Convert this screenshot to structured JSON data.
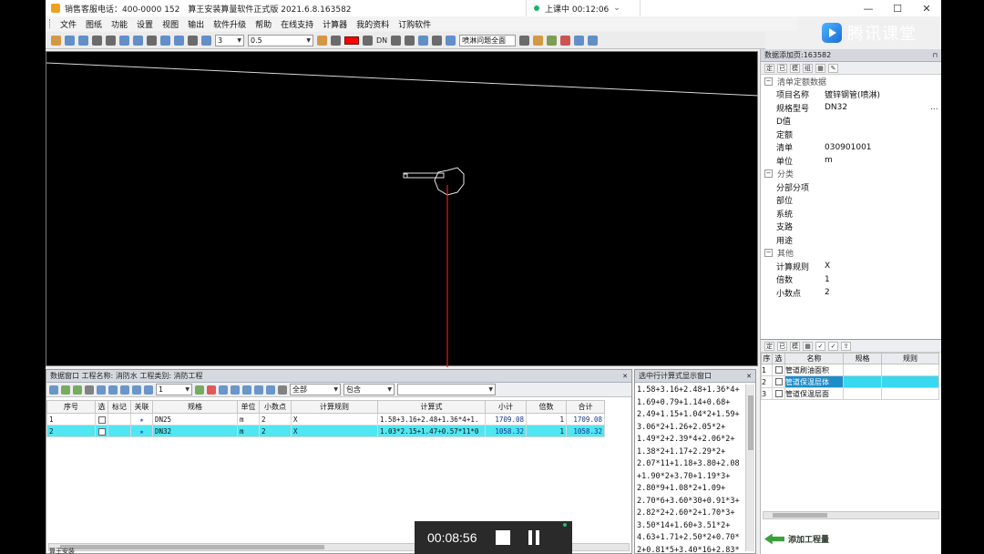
{
  "title_bar": {
    "title": "销售客服电话：400-0000 152　算王安装算量软件正式版 2021.6.8.163582",
    "class_status_label": "上课中 00:12:06"
  },
  "brand": {
    "name": "腾讯课堂"
  },
  "menu": [
    "文件",
    "图纸",
    "功能",
    "设置",
    "视图",
    "输出",
    "软件升级",
    "帮助",
    "在线支持",
    "计算器",
    "我的资料",
    "订购软件"
  ],
  "toolbar": {
    "line_width_value": "3",
    "scale_value": "0.5",
    "dn_label": "DN",
    "layer_combo": "喷淋问题全面",
    "color_swatch": "#ff0000"
  },
  "prop_panel": {
    "header": "数据添加页:163582",
    "tool_labels": [
      "定",
      "已",
      "模",
      "组"
    ],
    "groups": [
      {
        "name": "清单定额数据",
        "rows": [
          {
            "key": "项目名称",
            "value": "镀锌钢管(喷淋)"
          },
          {
            "key": "规格型号",
            "value": "DN32"
          },
          {
            "key": "D值",
            "value": ""
          },
          {
            "key": "定额",
            "value": ""
          },
          {
            "key": "清单",
            "value": "030901001"
          },
          {
            "key": "单位",
            "value": "m"
          }
        ]
      },
      {
        "name": "分类",
        "rows": [
          {
            "key": "分部分项",
            "value": ""
          },
          {
            "key": "部位",
            "value": ""
          },
          {
            "key": "系统",
            "value": ""
          },
          {
            "key": "支路",
            "value": ""
          },
          {
            "key": "用途",
            "value": ""
          }
        ]
      },
      {
        "name": "其他",
        "rows": [
          {
            "key": "计算规则",
            "value": "X"
          },
          {
            "key": "倍数",
            "value": "1"
          },
          {
            "key": "小数点",
            "value": "2"
          }
        ]
      }
    ],
    "dots_label": "..."
  },
  "list_panel": {
    "tool_labels": [
      "定",
      "已",
      "模"
    ],
    "headers": [
      "序",
      "选",
      "名称",
      "规格",
      "规则"
    ],
    "rows": [
      {
        "idx": "1",
        "name": "管道刷油面积"
      },
      {
        "idx": "2",
        "name": "管道保温层体"
      },
      {
        "idx": "3",
        "name": "管道保温层面"
      }
    ],
    "add_button": "添加工程量"
  },
  "data_window": {
    "header": "数据窗口  工程名称: 消防水  工程类别: 消防工程",
    "toolbar": {
      "count_value": "1",
      "filter_value": "全部",
      "match_value": "包含"
    },
    "headers": [
      "序号",
      "选",
      "标记",
      "关联",
      "规格",
      "单位",
      "小数点",
      "计算规则",
      "计算式",
      "小计",
      "倍数",
      "合计"
    ],
    "rows": [
      {
        "idx": "1",
        "spec": "DN25",
        "unit": "m",
        "decimals": "2",
        "rule": "X",
        "formula": "1.58+3.16+2.48+1.36*4+1.",
        "subtotal": "1709.08",
        "multiple": "1",
        "total": "1709.08"
      },
      {
        "idx": "2",
        "spec": "DN32",
        "unit": "m",
        "decimals": "2",
        "rule": "X",
        "formula": "1.03*2.15+1.47+0.57*11*0",
        "subtotal": "1058.32",
        "multiple": "1",
        "total": "1058.32"
      }
    ]
  },
  "formula_window": {
    "header": "选中行计算式显示窗口",
    "lines": [
      "1.58+3.16+2.48+1.36*4+",
      "1.69+0.79+1.14+0.68+",
      "2.49+1.15+1.04*2+1.59+",
      "3.06*2+1.26+2.05*2+",
      "1.49*2+2.39*4+2.06*2+",
      "1.38*2+1.17+2.29*2+",
      "2.07*11+1.18+3.80+2.08",
      "+1.90*2+3.70+1.19*3+",
      "2.80*9+1.08*2+1.09+",
      "2.70*6+3.60*30+0.91*3+",
      "2.82*2+2.60*2+1.70*3+",
      "3.50*14+1.60+3.51*2+",
      "4.63+1.71+2.50*2+0.70*",
      "2+0.81*5+3.40*16+2.83*"
    ]
  },
  "player": {
    "time": "00:08:56"
  },
  "status_text": "算王安装"
}
